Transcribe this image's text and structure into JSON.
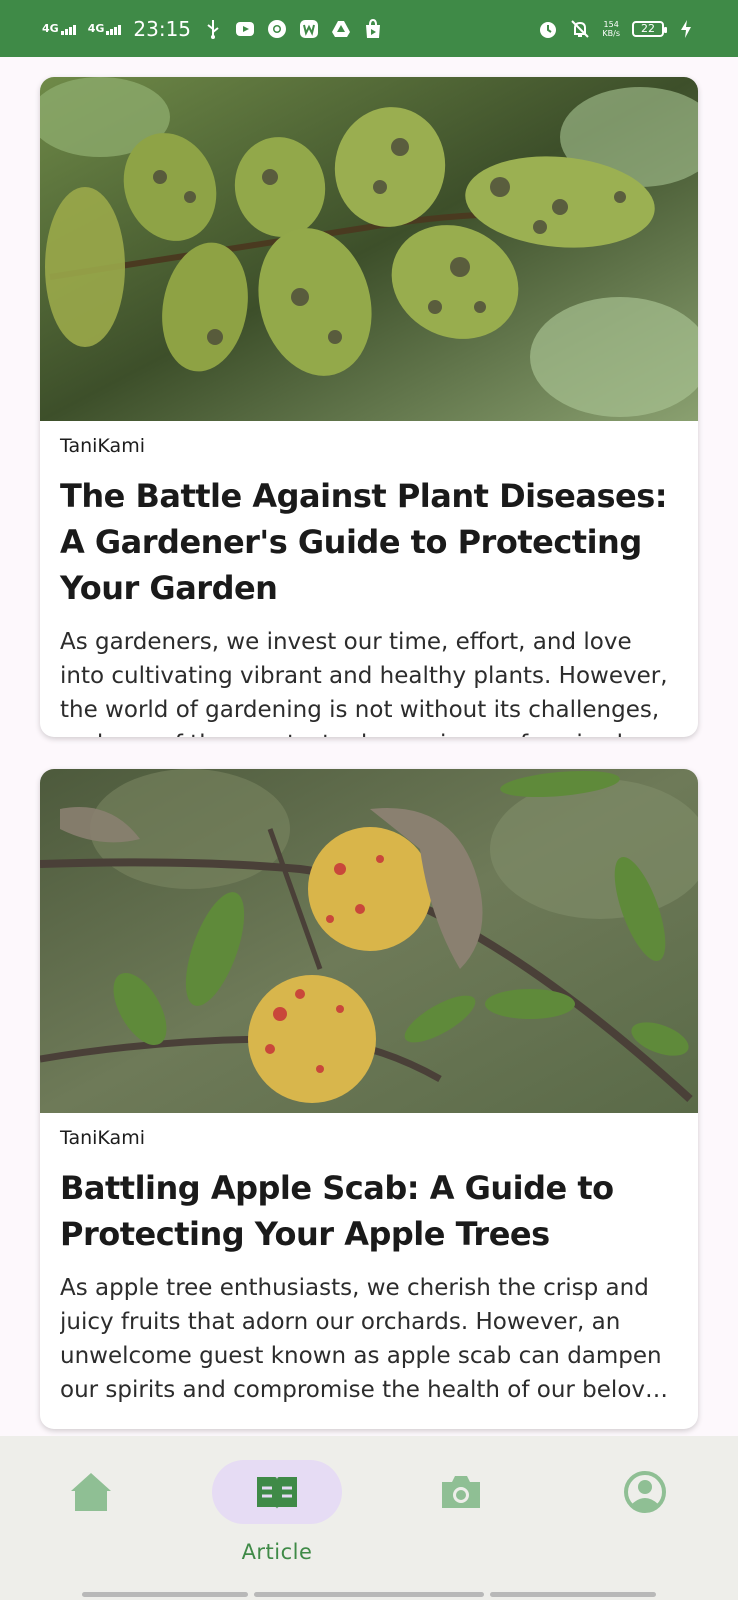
{
  "status_bar": {
    "network_1": "4G",
    "network_2": "4G",
    "time": "23:15",
    "speed_value": "154",
    "speed_unit": "KB/s",
    "battery": "22"
  },
  "articles": [
    {
      "author": "TaniKami",
      "title": "The Battle Against Plant Diseases: A Gardener's Guide to Protecting Your Garden",
      "excerpt": "As gardeners, we invest our time, effort, and love into cultivating vibrant and healthy plants. However, the world of gardening is not without its challenges, and one of the greatest adversaries we face is plant diseases. These stea..."
    },
    {
      "author": "TaniKami",
      "title": "Battling Apple Scab: A Guide to Protecting Your Apple Trees",
      "excerpt": "As apple tree enthusiasts, we cherish the crisp and juicy fruits that adorn our orchards. However, an unwelcome guest known as apple scab can dampen our spirits and compromise the health of our beloved trees. Apple scab is..."
    }
  ],
  "bottom_nav": {
    "items": [
      {
        "icon": "home-icon",
        "label": ""
      },
      {
        "icon": "article-icon",
        "label": "Article"
      },
      {
        "icon": "camera-icon",
        "label": ""
      },
      {
        "icon": "profile-icon",
        "label": ""
      }
    ],
    "active_color": "#3f8a47",
    "inactive_color": "#8fbf94",
    "active_pill_color": "#e6dcf4"
  },
  "colors": {
    "status_bar": "#3f8a47",
    "background": "#fdf8fc"
  }
}
